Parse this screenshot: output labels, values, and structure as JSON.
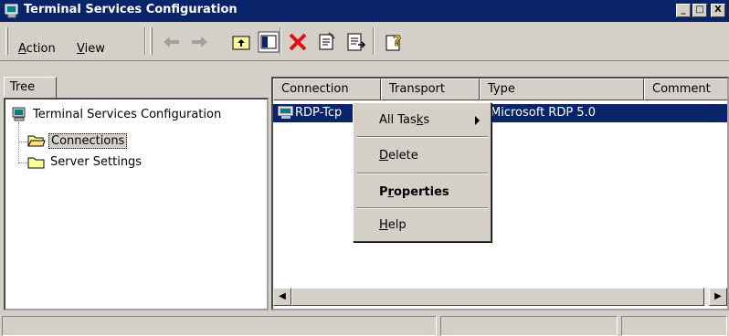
{
  "window": {
    "title": "Terminal Services Configuration"
  },
  "titlebar_buttons": {
    "minimize": "_",
    "maximize": "□",
    "close": "X"
  },
  "menu": {
    "action": {
      "underline": "A",
      "rest": "ction"
    },
    "view": {
      "underline": "V",
      "rest": "iew"
    }
  },
  "tree": {
    "tab_label": "Tree",
    "root_label": "Terminal Services Configuration",
    "children": [
      "Connections",
      "Server Settings"
    ]
  },
  "list": {
    "columns": [
      "Connection",
      "Transport",
      "Type",
      "Comment"
    ],
    "rows": [
      {
        "connection": "RDP-Tcp",
        "type": "Microsoft RDP 5.0"
      }
    ]
  },
  "context_menu": {
    "all_tasks": {
      "before": "All Tas",
      "underline": "k",
      "after": "s"
    },
    "delete": {
      "underline": "D",
      "rest": "elete"
    },
    "properties": {
      "before": "P",
      "underline": "r",
      "after": "operties"
    },
    "help": {
      "underline": "H",
      "rest": "elp"
    }
  },
  "colors": {
    "titlebar": "#0a246a",
    "face": "#d4d0c8",
    "selection": "#0a246a",
    "delete_icon": "#e01010"
  }
}
